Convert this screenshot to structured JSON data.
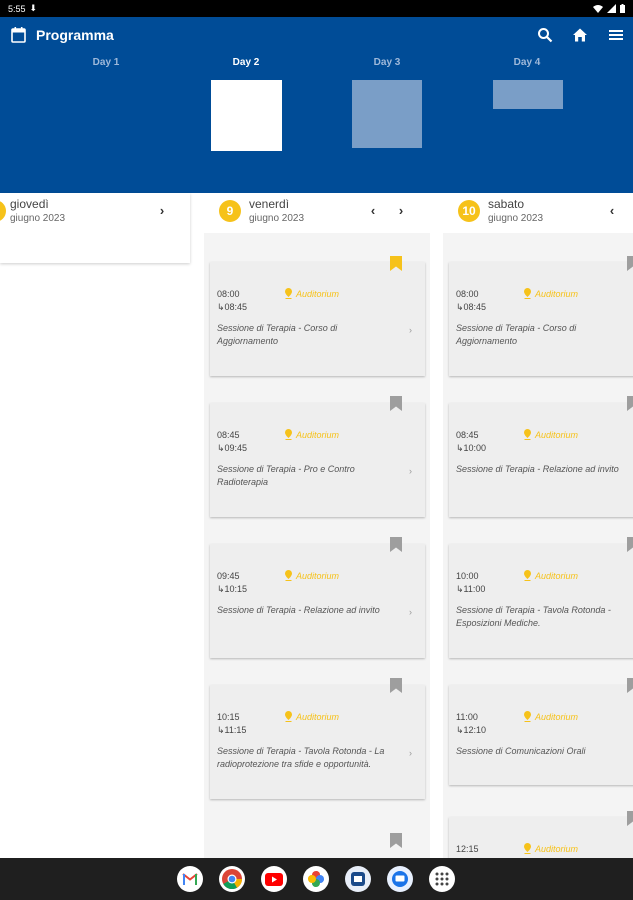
{
  "status_bar": {
    "time": "5:55"
  },
  "toolbar": {
    "title": "Programma"
  },
  "day_tabs": [
    {
      "label": "Day 1"
    },
    {
      "label": "Day 2"
    },
    {
      "label": "Day 3"
    },
    {
      "label": "Day 4"
    }
  ],
  "columns": [
    {
      "weekday": "giovedì",
      "monthyear": "giugno 2023"
    },
    {
      "day": "9",
      "weekday": "venerdì",
      "monthyear": "giugno 2023"
    },
    {
      "day": "10",
      "weekday": "sabato",
      "monthyear": "giugno 2023"
    }
  ],
  "sessions_col2": [
    {
      "start": "08:00",
      "end": "↳08:45",
      "location": "Auditorium",
      "title": "Sessione di Terapia - Corso di Aggiornamento",
      "bookmarked": true
    },
    {
      "start": "08:45",
      "end": "↳09:45",
      "location": "Auditorium",
      "title": "Sessione di Terapia - Pro e Contro Radioterapia",
      "bookmarked": false
    },
    {
      "start": "09:45",
      "end": "↳10:15",
      "location": "Auditorium",
      "title": "Sessione di Terapia - Relazione ad invito",
      "bookmarked": false
    },
    {
      "start": "10:15",
      "end": "↳11:15",
      "location": "Auditorium",
      "title": "Sessione di Terapia - Tavola Rotonda - La radioprotezione tra sfide e opportunità.",
      "bookmarked": false
    }
  ],
  "sessions_col3": [
    {
      "start": "08:00",
      "end": "↳08:45",
      "location": "Auditorium",
      "title": "Sessione di Terapia - Corso di Aggiornamento"
    },
    {
      "start": "08:45",
      "end": "↳10:00",
      "location": "Auditorium",
      "title": "Sessione di Terapia - Relazione ad invito"
    },
    {
      "start": "10:00",
      "end": "↳11:00",
      "location": "Auditorium",
      "title": "Sessione di Terapia - Tavola Rotonda - Esposizioni Mediche."
    },
    {
      "start": "11:00",
      "end": "↳12:10",
      "location": "Auditorium",
      "title": "Sessione di Comunicazioni Orali"
    },
    {
      "start": "12:15",
      "location": "Auditorium"
    }
  ],
  "colors": {
    "primary": "#004c97",
    "accent": "#f6c21a"
  },
  "dock": [
    "gmail-icon",
    "chrome-icon",
    "youtube-icon",
    "photos-icon",
    "app-icon",
    "messages-icon",
    "app-drawer-icon"
  ]
}
